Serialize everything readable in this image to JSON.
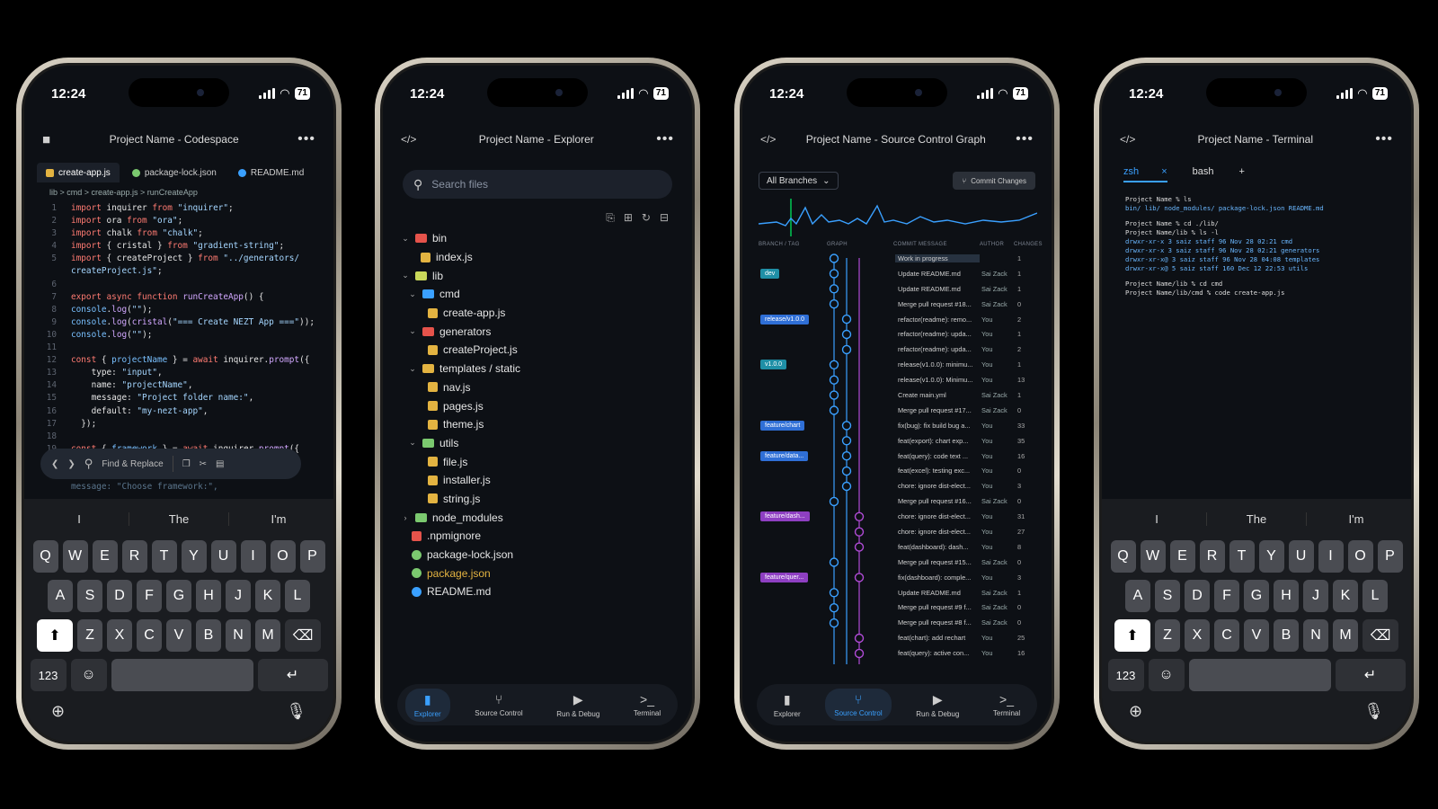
{
  "status": {
    "time": "12:24",
    "battery": "71"
  },
  "codespace": {
    "title": "Project Name - Codespace",
    "tabs": [
      "create-app.js",
      "package-lock.json",
      "README.md"
    ],
    "breadcrumb": "lib > cmd > create-app.js > runCreateApp",
    "find_label": "Find & Replace",
    "last_line": "message: \"Choose framework:\","
  },
  "keyboard": {
    "suggestions": [
      "I",
      "The",
      "I'm"
    ],
    "row1": [
      "Q",
      "W",
      "E",
      "R",
      "T",
      "Y",
      "U",
      "I",
      "O",
      "P"
    ],
    "row2": [
      "A",
      "S",
      "D",
      "F",
      "G",
      "H",
      "J",
      "K",
      "L"
    ],
    "row3": [
      "Z",
      "X",
      "C",
      "V",
      "B",
      "N",
      "M"
    ],
    "numbers": "123"
  },
  "explorer": {
    "title": "Project Name - Explorer",
    "search_placeholder": "Search files",
    "tree": [
      {
        "label": "bin",
        "depth": 0,
        "type": "folder",
        "open": true,
        "color": "#e5534b"
      },
      {
        "label": "index.js",
        "depth": 1,
        "type": "js"
      },
      {
        "label": "lib",
        "depth": 0,
        "type": "folder",
        "open": true,
        "color": "#c9d85a"
      },
      {
        "label": "cmd",
        "depth": 1,
        "type": "folder",
        "open": true,
        "color": "#3aa0ff"
      },
      {
        "label": "create-app.js",
        "depth": 2,
        "type": "js"
      },
      {
        "label": "generators",
        "depth": 1,
        "type": "folder",
        "open": true,
        "color": "#e5534b"
      },
      {
        "label": "createProject.js",
        "depth": 2,
        "type": "js"
      },
      {
        "label": "templates / static",
        "depth": 1,
        "type": "folder",
        "open": true,
        "color": "#e3b341"
      },
      {
        "label": "nav.js",
        "depth": 2,
        "type": "js"
      },
      {
        "label": "pages.js",
        "depth": 2,
        "type": "js"
      },
      {
        "label": "theme.js",
        "depth": 2,
        "type": "js"
      },
      {
        "label": "utils",
        "depth": 1,
        "type": "folder",
        "open": true,
        "color": "#7bc96f"
      },
      {
        "label": "file.js",
        "depth": 2,
        "type": "js"
      },
      {
        "label": "installer.js",
        "depth": 2,
        "type": "js"
      },
      {
        "label": "string.js",
        "depth": 2,
        "type": "js"
      },
      {
        "label": "node_modules",
        "depth": 0,
        "type": "folder",
        "open": false,
        "color": "#7bc96f"
      },
      {
        "label": ".npmignore",
        "depth": 0,
        "type": "npm"
      },
      {
        "label": "package-lock.json",
        "depth": 0,
        "type": "pkg"
      },
      {
        "label": "package.json",
        "depth": 0,
        "type": "pkg",
        "highlight": true
      },
      {
        "label": "README.md",
        "depth": 0,
        "type": "info"
      }
    ]
  },
  "nav": [
    "Explorer",
    "Source Control",
    "Run & Debug",
    "Terminal"
  ],
  "graph": {
    "title": "Project Name - Source Control Graph",
    "branch_select": "All Branches",
    "commit_button": "Commit Changes",
    "headers": [
      "BRANCH / TAG",
      "GRAPH",
      "COMMIT MESSAGE",
      "AUTHOR",
      "CHANGES"
    ],
    "rows": [
      {
        "badge": "",
        "msg": "Work in progress",
        "author": "",
        "changes": "1"
      },
      {
        "badge": "dev",
        "badge_color": "#1f8fa6",
        "msg": "Update README.md",
        "author": "Sai Zack",
        "changes": "1"
      },
      {
        "badge": "",
        "msg": "Update README.md",
        "author": "Sai Zack",
        "changes": "1"
      },
      {
        "badge": "",
        "msg": "Merge pull request #18...",
        "author": "Sai Zack",
        "changes": "0"
      },
      {
        "badge": "release/v1.0.0",
        "badge_color": "#2f6fd6",
        "msg": "refactor(readme): remo...",
        "author": "You",
        "changes": "2"
      },
      {
        "badge": "",
        "msg": "refactor(readme): upda...",
        "author": "You",
        "changes": "1"
      },
      {
        "badge": "",
        "msg": "refactor(readme): upda...",
        "author": "You",
        "changes": "2"
      },
      {
        "badge": "v1.0.0",
        "badge_color": "#1f8fa6",
        "msg": "release(v1.0.0): minimu...",
        "author": "You",
        "changes": "1"
      },
      {
        "badge": "",
        "msg": "release(v1.0.0): Minimu...",
        "author": "You",
        "changes": "13"
      },
      {
        "badge": "",
        "msg": "Create main.yml",
        "author": "Sai Zack",
        "changes": "1"
      },
      {
        "badge": "",
        "msg": "Merge pull request #17...",
        "author": "Sai Zack",
        "changes": "0"
      },
      {
        "badge": "feature/chart",
        "badge_color": "#2f6fd6",
        "msg": "fix(bug): fix build bug a...",
        "author": "You",
        "changes": "33"
      },
      {
        "badge": "",
        "msg": "feat(export): chart exp...",
        "author": "You",
        "changes": "35"
      },
      {
        "badge": "feature/data...",
        "badge_color": "#2f6fd6",
        "msg": "feat(query): code text ...",
        "author": "You",
        "changes": "16"
      },
      {
        "badge": "",
        "msg": "feat(excel): testing exc...",
        "author": "You",
        "changes": "0"
      },
      {
        "badge": "",
        "msg": "chore: ignore dist-elect...",
        "author": "You",
        "changes": "3"
      },
      {
        "badge": "",
        "msg": "Merge pull request #16...",
        "author": "Sai Zack",
        "changes": "0"
      },
      {
        "badge": "feature/dash...",
        "badge_color": "#8e3fc2",
        "msg": "chore: ignore dist-elect...",
        "author": "You",
        "changes": "31"
      },
      {
        "badge": "",
        "msg": "chore: ignore dist-elect...",
        "author": "You",
        "changes": "27"
      },
      {
        "badge": "",
        "msg": "feat(dashboard): dash...",
        "author": "You",
        "changes": "8"
      },
      {
        "badge": "",
        "msg": "Merge pull request #15...",
        "author": "Sai Zack",
        "changes": "0"
      },
      {
        "badge": "feature/quer...",
        "badge_color": "#8e3fc2",
        "msg": "fix(dashboard): comple...",
        "author": "You",
        "changes": "3"
      },
      {
        "badge": "",
        "msg": "Update README.md",
        "author": "Sai Zack",
        "changes": "1"
      },
      {
        "badge": "",
        "msg": "Merge pull request #9 f...",
        "author": "Sai Zack",
        "changes": "0"
      },
      {
        "badge": "",
        "msg": "Merge pull request #8 f...",
        "author": "Sai Zack",
        "changes": "0"
      },
      {
        "badge": "",
        "msg": "feat(chart): add rechart",
        "author": "You",
        "changes": "25"
      },
      {
        "badge": "",
        "msg": "feat(query): active con...",
        "author": "You",
        "changes": "16"
      }
    ]
  },
  "terminal": {
    "title": "Project Name - Terminal",
    "tabs": [
      "zsh",
      "bash"
    ],
    "lines": [
      "Project Name % ls",
      "bin/    lib/    node_modules/    package-lock.json    README.md",
      "",
      "Project Name % cd ./lib/",
      "Project Name/lib % ls -l",
      "drwxr-xr-x  3 saiz  staff   96 Nov 28 02:21 cmd",
      "drwxr-xr-x  3 saiz  staff   96 Nov 28 02:21 generators",
      "drwxr-xr-x@ 3 saiz  staff   96 Nov 28 04:08 templates",
      "drwxr-xr-x@ 5 saiz  staff  160 Dec 12 22:53 utils",
      "",
      "Project Name/lib % cd cmd",
      "Project Name/lib/cmd % code create-app.js"
    ]
  },
  "colors": {
    "accent": "#3aa0ff",
    "graph_line": "#3aa0ff",
    "wip": "#00c853"
  }
}
